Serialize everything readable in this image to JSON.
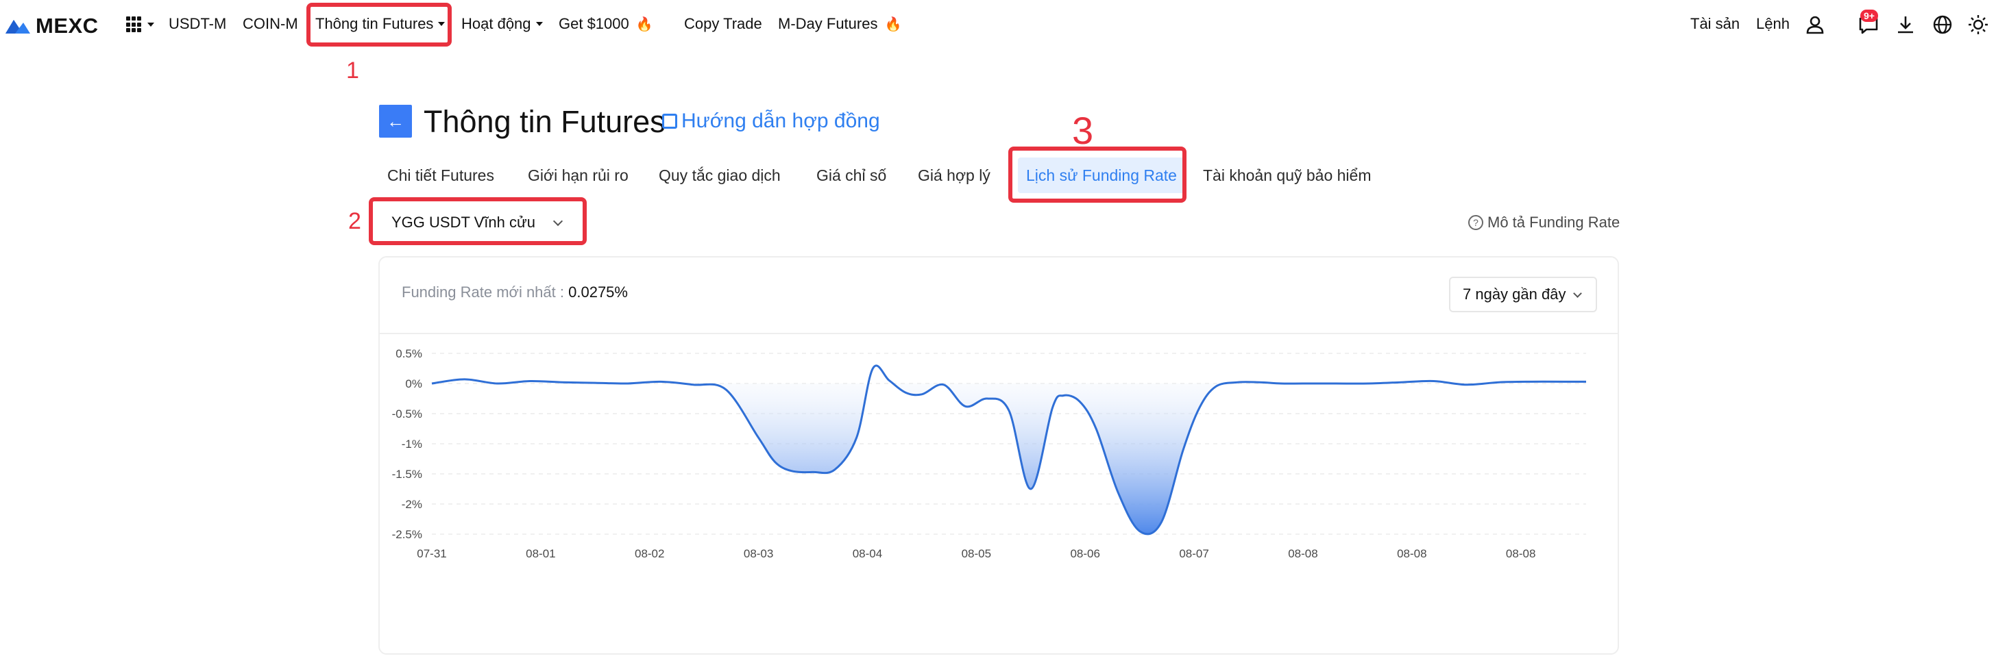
{
  "brand": {
    "name": "MEXC",
    "accent": "#2f7ff0",
    "annotation_color": "#e8323f"
  },
  "nav": {
    "items": [
      {
        "key": "usdt_m",
        "label": "USDT-M"
      },
      {
        "key": "coin_m",
        "label": "COIN-M"
      },
      {
        "key": "futures_info",
        "label": "Thông tin Futures"
      },
      {
        "key": "activities",
        "label": "Hoạt động"
      },
      {
        "key": "get1000",
        "label": "Get $1000"
      },
      {
        "key": "copy_trade",
        "label": "Copy Trade"
      },
      {
        "key": "mday",
        "label": "M-Day Futures"
      }
    ],
    "right": {
      "assets": "Tài sản",
      "orders": "Lệnh",
      "notif_badge": "9+"
    }
  },
  "annotations": {
    "n1": "1",
    "n2": "2",
    "n3": "3"
  },
  "page": {
    "title": "Thông tin Futures",
    "guide_link": "Hướng dẫn hợp đồng",
    "back_icon": "arrow-left-icon"
  },
  "tabs": [
    {
      "label": "Chi tiết Futures"
    },
    {
      "label": "Giới hạn rủi ro"
    },
    {
      "label": "Quy tắc giao dịch"
    },
    {
      "label": "Giá chỉ số"
    },
    {
      "label": "Giá hợp lý"
    },
    {
      "label": "Lịch sử Funding Rate",
      "active": true
    },
    {
      "label": "Tài khoản quỹ bảo hiểm"
    }
  ],
  "selector": {
    "value": "YGG USDT Vĩnh cửu"
  },
  "description_link": "Mô tả Funding Rate",
  "card": {
    "latest_label": "Funding Rate mới nhất :",
    "latest_value": "0.0275%",
    "range": "7 ngày gần đây"
  },
  "chart_data": {
    "type": "area",
    "title": "",
    "xlabel": "",
    "ylabel": "",
    "ylim": [
      -2.5,
      0.5
    ],
    "y_ticks": [
      "0.5%",
      "0%",
      "-0.5%",
      "-1%",
      "-1.5%",
      "-2%",
      "-2.5%"
    ],
    "y_tick_values": [
      0.5,
      0,
      -0.5,
      -1,
      -1.5,
      -2,
      -2.5
    ],
    "x_tick_labels": [
      "07-31",
      "08-01",
      "08-02",
      "08-03",
      "08-04",
      "08-05",
      "08-06",
      "08-07",
      "08-08",
      "08-08",
      "08-08"
    ],
    "x_range": [
      0,
      10.6
    ],
    "grid": true,
    "line_color": "#2f6fd6",
    "fill_color": "#5b93ec",
    "series": [
      {
        "x": [
          0,
          0.3,
          0.6,
          0.9,
          1.2,
          1.5,
          1.8,
          2.1,
          2.4,
          2.7,
          3.0,
          3.15,
          3.3,
          3.5,
          3.7,
          3.9,
          4.05,
          4.2,
          4.35,
          4.5,
          4.7,
          4.9,
          5.1,
          5.3,
          5.5,
          5.7,
          5.8,
          5.95,
          6.1,
          6.3,
          6.5,
          6.7,
          6.9,
          7.05,
          7.2,
          7.4,
          7.6,
          7.8,
          8.0,
          8.3,
          8.6,
          8.9,
          9.2,
          9.5,
          9.8,
          10.1,
          10.4,
          10.6
        ],
        "y": [
          0.0,
          0.07,
          0.0,
          0.04,
          0.02,
          0.01,
          0.0,
          0.03,
          -0.02,
          -0.1,
          -0.9,
          -1.3,
          -1.45,
          -1.47,
          -1.43,
          -0.9,
          0.25,
          0.05,
          -0.15,
          -0.18,
          -0.02,
          -0.38,
          -0.25,
          -0.45,
          -1.75,
          -0.4,
          -0.2,
          -0.3,
          -0.75,
          -1.8,
          -2.45,
          -2.3,
          -1.1,
          -0.4,
          -0.05,
          0.02,
          0.02,
          0.0,
          0.0,
          0.0,
          0.0,
          0.02,
          0.04,
          -0.02,
          0.02,
          0.03,
          0.03,
          0.03
        ]
      }
    ]
  }
}
